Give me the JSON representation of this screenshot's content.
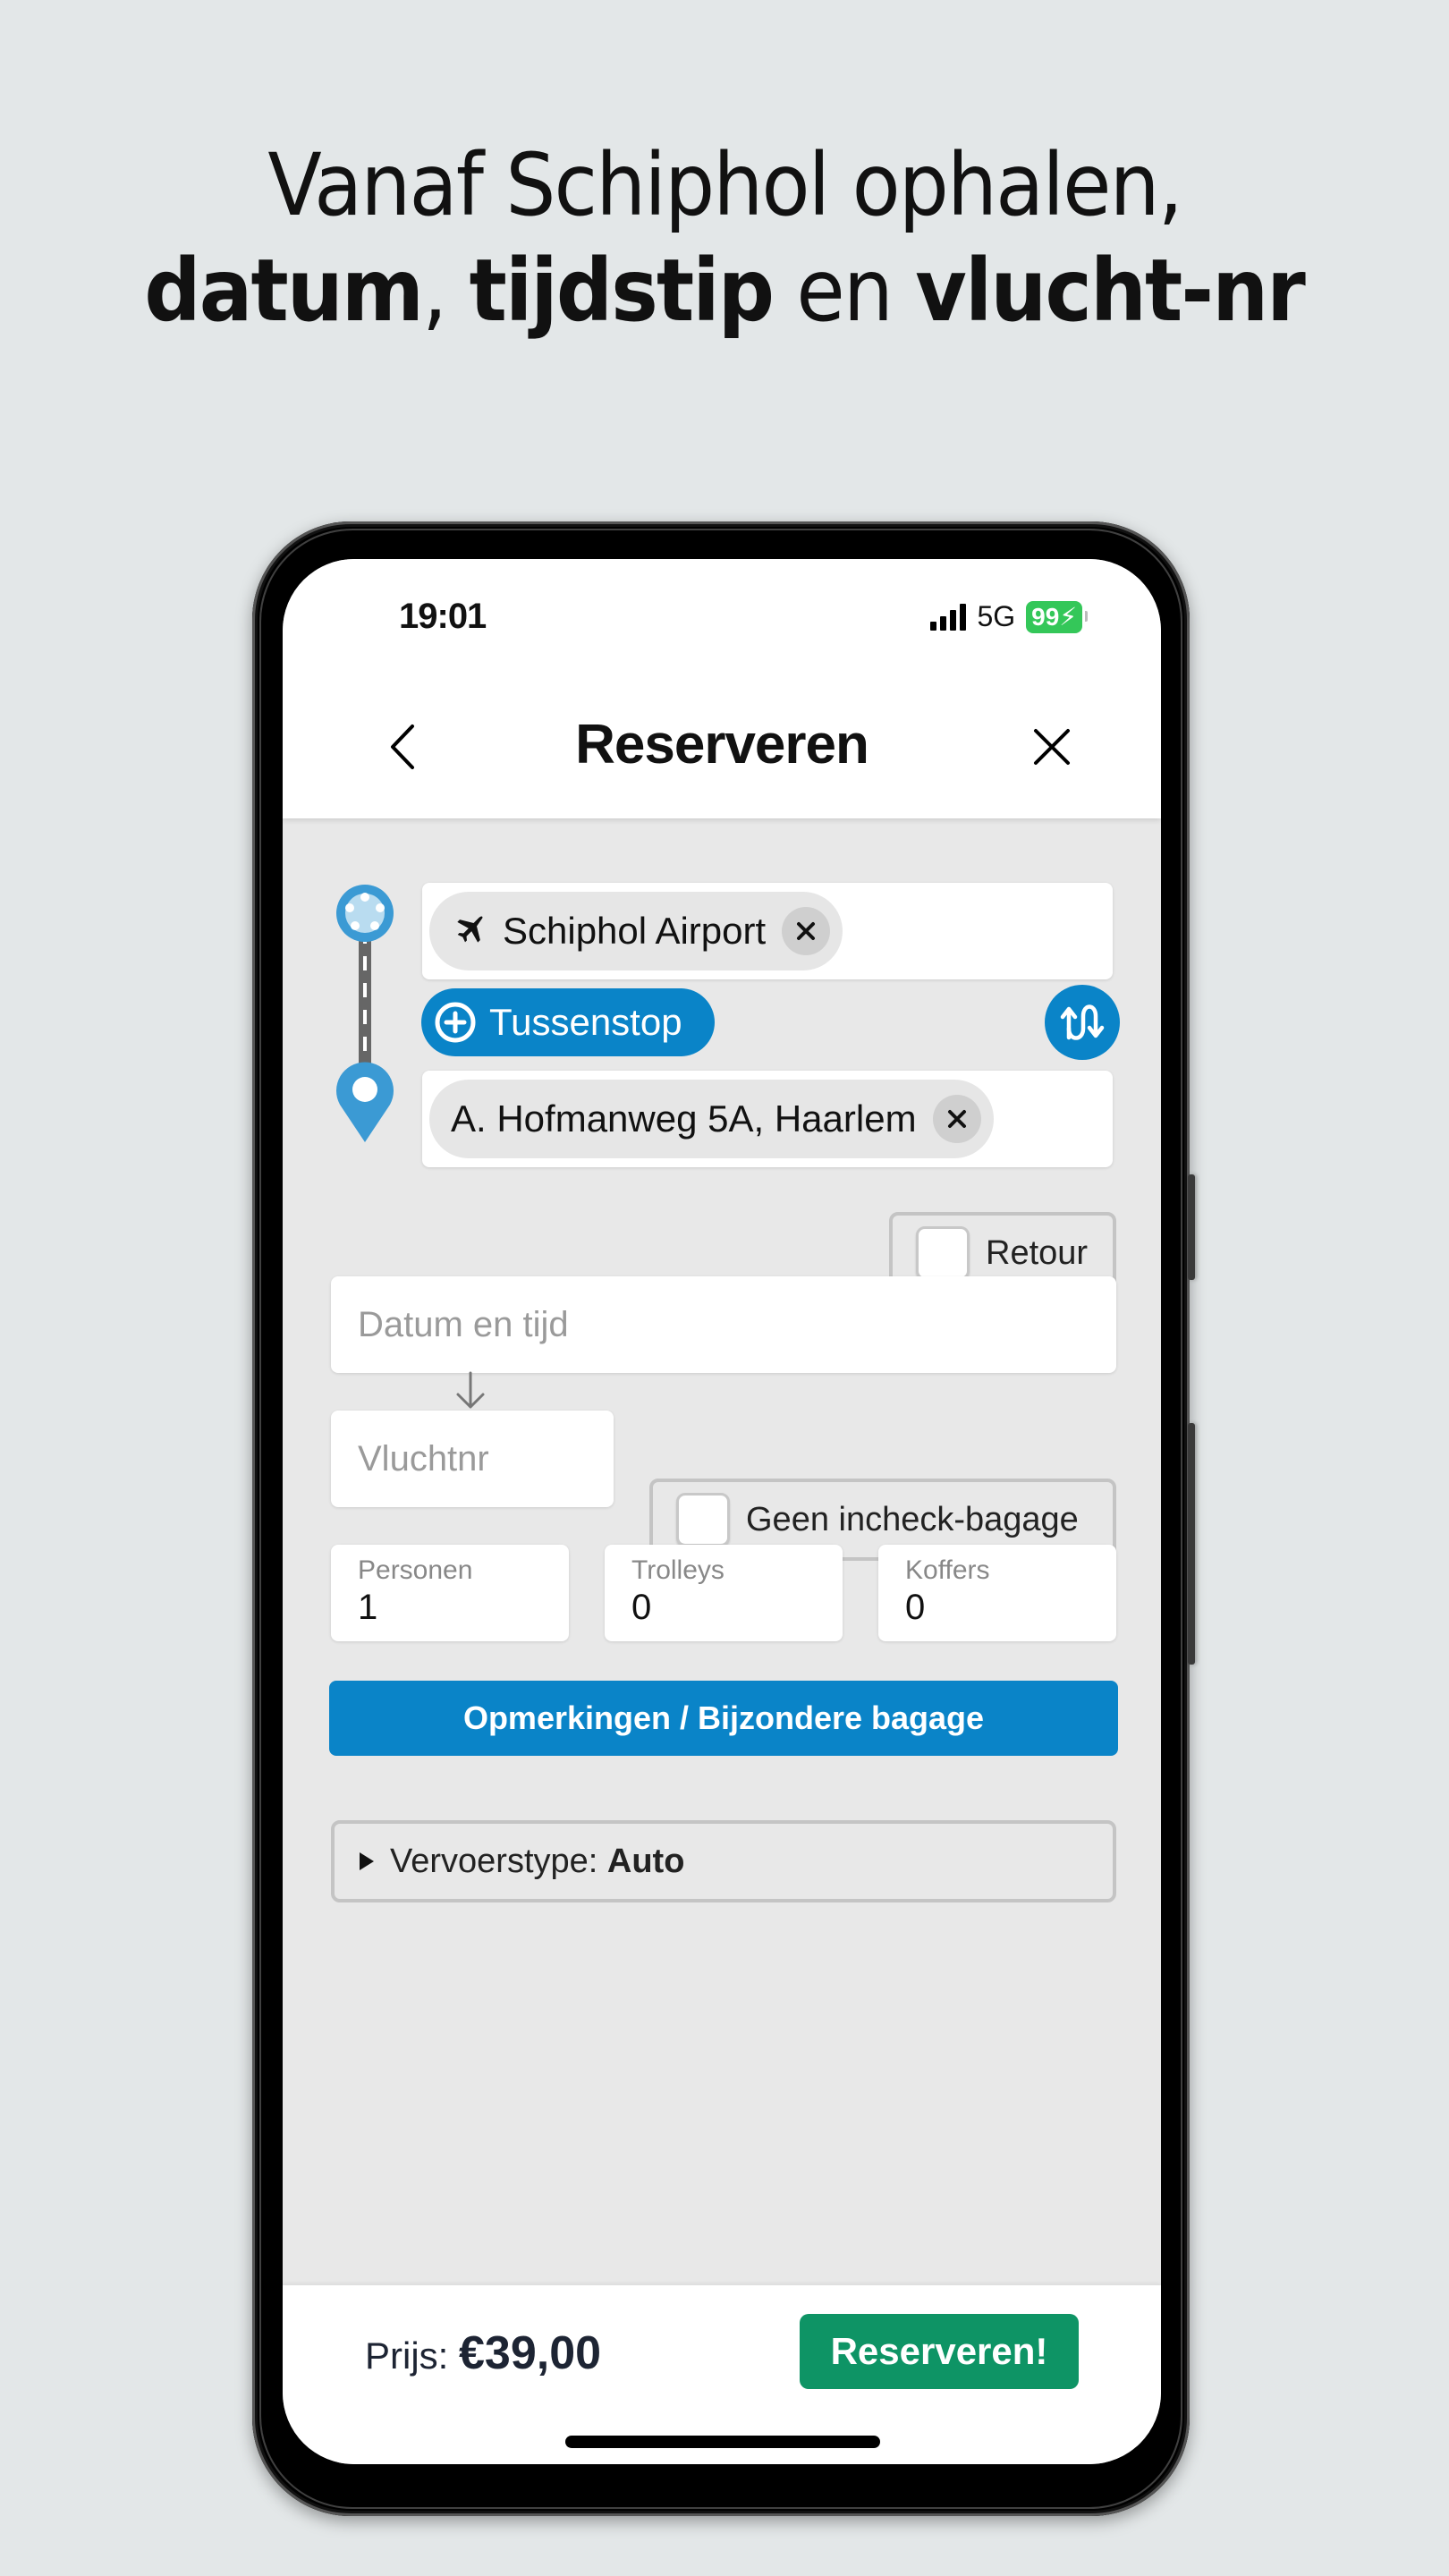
{
  "headline": {
    "line1": "Vanaf Schiphol ophalen,",
    "line2": [
      {
        "text": "datum",
        "bold": true
      },
      {
        "text": ", ",
        "bold": false
      },
      {
        "text": "tijdstip",
        "bold": true
      },
      {
        "text": " en ",
        "bold": false
      },
      {
        "text": "vlucht-nr",
        "bold": true
      }
    ]
  },
  "status_bar": {
    "time": "19:01",
    "network": "5G",
    "battery": "99",
    "battery_charging": true,
    "signal_bars": 4
  },
  "header": {
    "title": "Reserveren",
    "back_icon": "chevron-left-icon",
    "close_icon": "close-icon"
  },
  "route": {
    "from": {
      "label": "Schiphol Airport",
      "icon": "airplane-icon"
    },
    "stopover_button": "Tussenstop",
    "swap_icon": "swap-icon",
    "to": {
      "label": "A. Hofmanweg 5A, Haarlem"
    }
  },
  "options": {
    "retour_label": "Retour",
    "retour_checked": false,
    "datetime_placeholder": "Datum en tijd",
    "flight_placeholder": "Vluchtnr",
    "no_checkin_label": "Geen incheck-bagage",
    "no_checkin_checked": false
  },
  "counters": [
    {
      "label": "Personen",
      "value": "1"
    },
    {
      "label": "Trolleys",
      "value": "0"
    },
    {
      "label": "Koffers",
      "value": "0"
    }
  ],
  "remarks_button": "Opmerkingen / Bijzondere bagage",
  "vehicle": {
    "label": "Vervoerstype: ",
    "value": "Auto"
  },
  "footer": {
    "price_label": "Prijs: ",
    "price_value": "€39,00",
    "reserve_button": "Reserveren!"
  },
  "colors": {
    "primary_blue": "#0a84c8",
    "reserve_green": "#0e9465",
    "battery_green": "#34c759",
    "route_blue": "#3b9ad4"
  }
}
